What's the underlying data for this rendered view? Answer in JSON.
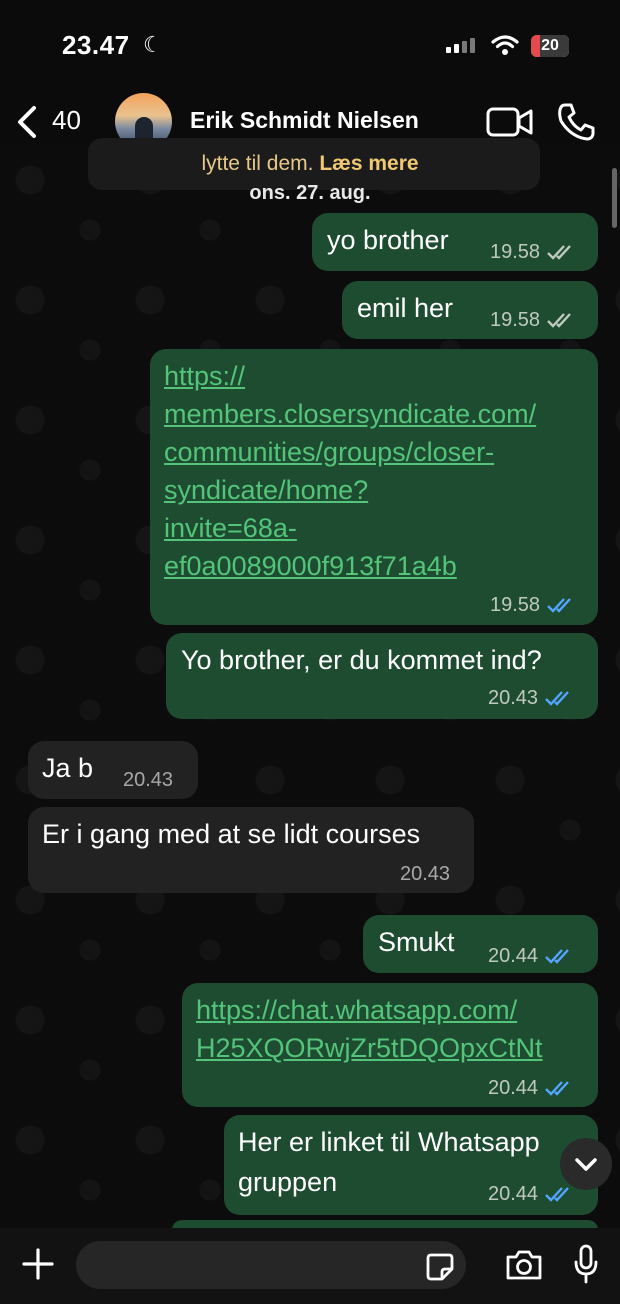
{
  "status_bar": {
    "time": "23.47",
    "battery": "20"
  },
  "header": {
    "back_count": "40",
    "contact_name": "Erik Schmidt Nielsen"
  },
  "previous_message": {
    "text": "lytte til dem.",
    "read_more": "Læs mere"
  },
  "date_separator": "ons. 27. aug.",
  "messages": [
    {
      "direction": "out",
      "lines": [
        "yo brother"
      ],
      "time": "19.58",
      "status": "delivered"
    },
    {
      "direction": "out",
      "lines": [
        "emil her"
      ],
      "time": "19.58",
      "status": "delivered"
    },
    {
      "direction": "out",
      "is_link": true,
      "lines": [
        "https://",
        "members.closersyndicate.com/",
        "communities/groups/closer-",
        "syndicate/home?",
        "invite=68a-",
        "ef0a0089000f913f71a4b"
      ],
      "time": "19.58",
      "status": "read"
    },
    {
      "direction": "out",
      "lines": [
        "Yo brother, er du kommet ind?"
      ],
      "time": "20.43",
      "status": "read"
    },
    {
      "direction": "in",
      "lines": [
        "Ja b"
      ],
      "time": "20.43"
    },
    {
      "direction": "in",
      "lines": [
        "Er i gang med at se lidt courses"
      ],
      "time": "20.43"
    },
    {
      "direction": "out",
      "lines": [
        "Smukt"
      ],
      "time": "20.44",
      "status": "read"
    },
    {
      "direction": "out",
      "is_link": true,
      "lines": [
        "https://chat.whatsapp.com/",
        "H25XQORwjZr5tDQOpxCtNt"
      ],
      "time": "20.44",
      "status": "read"
    },
    {
      "direction": "out",
      "lines": [
        "Her er linket til Whatsapp",
        "gruppen"
      ],
      "time": "20.44",
      "status": "read"
    }
  ],
  "colors": {
    "outgoing_bubble": "#1e4c30",
    "incoming_bubble": "#222222",
    "link": "#53c47a",
    "read_ticks": "#53a6ff",
    "delivered_ticks": "#bfc9bf"
  },
  "icons": [
    "moon-icon",
    "signal-icon",
    "wifi-icon",
    "battery-icon",
    "back-chevron-icon",
    "video-call-icon",
    "phone-call-icon",
    "scroll-down-icon",
    "plus-icon",
    "sticker-icon",
    "camera-icon",
    "mic-icon"
  ]
}
